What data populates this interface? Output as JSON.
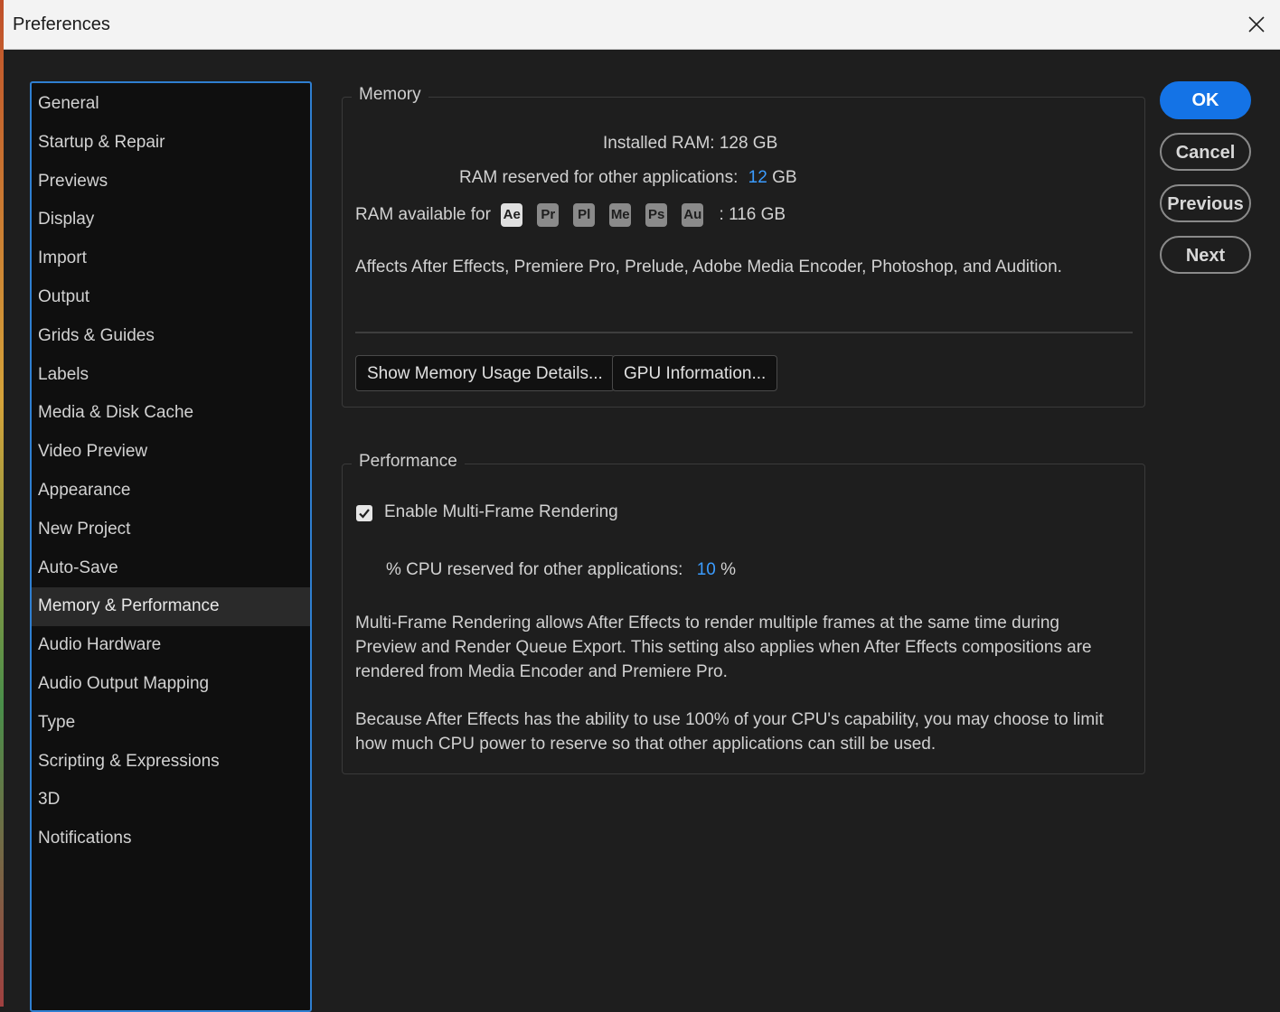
{
  "window": {
    "title": "Preferences"
  },
  "sidebar": {
    "items": [
      {
        "label": "General"
      },
      {
        "label": "Startup & Repair"
      },
      {
        "label": "Previews"
      },
      {
        "label": "Display"
      },
      {
        "label": "Import"
      },
      {
        "label": "Output"
      },
      {
        "label": "Grids & Guides"
      },
      {
        "label": "Labels"
      },
      {
        "label": "Media & Disk Cache"
      },
      {
        "label": "Video Preview"
      },
      {
        "label": "Appearance"
      },
      {
        "label": "New Project"
      },
      {
        "label": "Auto-Save"
      },
      {
        "label": "Memory & Performance"
      },
      {
        "label": "Audio Hardware"
      },
      {
        "label": "Audio Output Mapping"
      },
      {
        "label": "Type"
      },
      {
        "label": "Scripting & Expressions"
      },
      {
        "label": "3D"
      },
      {
        "label": "Notifications"
      }
    ],
    "selected": "Memory & Performance"
  },
  "memory": {
    "legend": "Memory",
    "installed_label": "Installed RAM:",
    "installed_value": "128 GB",
    "reserved_label": "RAM reserved for other applications:",
    "reserved_value": "12",
    "reserved_unit": "GB",
    "available_label": "RAM available for",
    "apps": [
      "Ae",
      "Pr",
      "Pl",
      "Me",
      "Ps",
      "Au"
    ],
    "available_sep": ":",
    "available_value": "116 GB",
    "affects_text": "Affects After Effects, Premiere Pro, Prelude, Adobe Media Encoder, Photoshop, and Audition.",
    "show_details_button": "Show Memory Usage Details...",
    "gpu_button": "GPU Information..."
  },
  "performance": {
    "legend": "Performance",
    "mfr_label": "Enable Multi-Frame Rendering",
    "mfr_checked": true,
    "cpu_label": "% CPU reserved for other applications:",
    "cpu_value": "10",
    "cpu_unit": "%",
    "para1": "Multi-Frame Rendering allows After Effects to render multiple frames at the same time during Preview and Render Queue Export. This setting also applies when After Effects compositions are rendered from Media Encoder and Premiere Pro.",
    "para2": "Because After Effects has the ability to use 100% of your CPU's capability, you may choose to limit how much CPU power to reserve so that other applications can still be used."
  },
  "actions": {
    "ok": "OK",
    "cancel": "Cancel",
    "previous": "Previous",
    "next": "Next"
  },
  "colors": {
    "accent": "#1473e6",
    "value_blue": "#3b9cff",
    "sidebar_border": "#2f7fd1"
  }
}
